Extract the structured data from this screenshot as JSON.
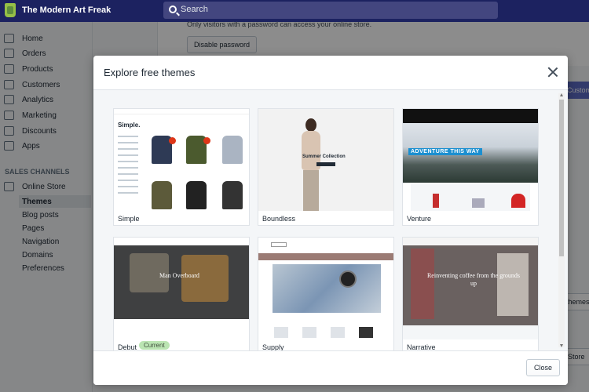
{
  "app": {
    "store_name": "The Modern Art Freak",
    "search_placeholder": "Search"
  },
  "sidebar": {
    "items": [
      {
        "label": "Home",
        "icon": "home-icon"
      },
      {
        "label": "Orders",
        "icon": "orders-icon"
      },
      {
        "label": "Products",
        "icon": "tag-icon"
      },
      {
        "label": "Customers",
        "icon": "customers-icon"
      },
      {
        "label": "Analytics",
        "icon": "analytics-icon"
      },
      {
        "label": "Marketing",
        "icon": "marketing-icon"
      },
      {
        "label": "Discounts",
        "icon": "discount-icon"
      },
      {
        "label": "Apps",
        "icon": "apps-icon"
      }
    ],
    "section_label": "SALES CHANNELS",
    "online_store": {
      "label": "Online Store",
      "icon": "store-icon"
    },
    "sub_items": [
      {
        "label": "Themes",
        "active": true
      },
      {
        "label": "Blog posts",
        "active": false
      },
      {
        "label": "Pages",
        "active": false
      },
      {
        "label": "Navigation",
        "active": false
      },
      {
        "label": "Domains",
        "active": false
      },
      {
        "label": "Preferences",
        "active": false
      }
    ]
  },
  "background_page": {
    "password_text": "Only visitors with a password can access your online store.",
    "disable_password_label": "Disable password",
    "right_btn_1": "Customize",
    "right_btn_2": "themes",
    "right_btn_3": "Store"
  },
  "modal": {
    "title": "Explore free themes",
    "close_label": "Close",
    "themes": [
      {
        "name": "Simple",
        "current": false
      },
      {
        "name": "Boundless",
        "current": false
      },
      {
        "name": "Venture",
        "current": false
      },
      {
        "name": "Debut",
        "current": true
      },
      {
        "name": "Supply",
        "current": false
      },
      {
        "name": "Narrative",
        "current": false
      }
    ],
    "current_badge": "Current",
    "thumb_text": {
      "simple_logo": "Simple.",
      "boundless_banner": "Summer Collection",
      "venture_banner": "ADVENTURE THIS WAY",
      "debut_banner": "Man Overboard",
      "narrative_banner": "Reinventing coffee from the grounds up"
    }
  },
  "colors": {
    "topbar": "#1c2260",
    "accent": "#5c6ac4",
    "current_badge": "#bbe5b3"
  }
}
